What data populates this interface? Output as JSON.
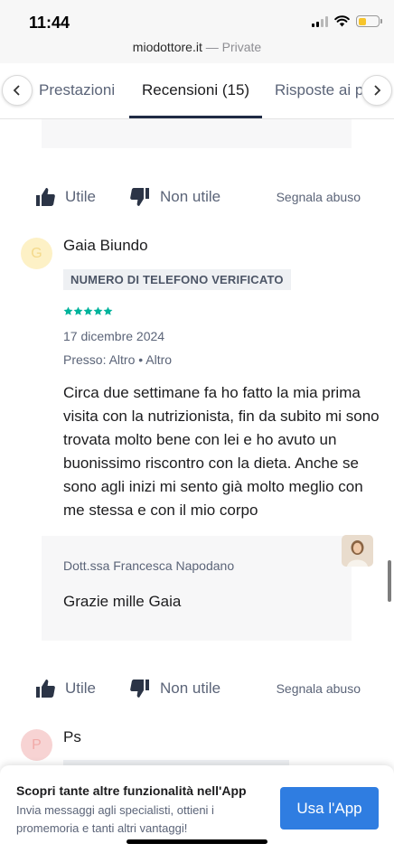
{
  "status_bar": {
    "time": "11:44",
    "battery_level": 0.4
  },
  "browser": {
    "domain": "miodottore.it",
    "mode": "— Private"
  },
  "tabs": [
    {
      "label": "Prestazioni",
      "active": false
    },
    {
      "label": "Recensioni (15)",
      "active": true
    },
    {
      "label": "Risposte ai p",
      "active": false
    }
  ],
  "actions": {
    "useful": "Utile",
    "not_useful": "Non utile",
    "report": "Segnala abuso"
  },
  "reviews": [
    {
      "initial": "G",
      "name": "Gaia Biundo",
      "badge": "NUMERO DI TELEFONO VERIFICATO",
      "rating": 5,
      "date": "17 dicembre 2024",
      "place": "Presso: Altro • Altro",
      "text": "Circa due settimane fa ho fatto la mia prima visita con la nutrizionista, fin da subito mi sono trovata molto bene con lei e ho avuto un buonissimo riscontro con la dieta. Anche se sono agli inizi mi sento già molto meglio con me stessa e con il mio corpo",
      "reply": {
        "author": "Dott.ssa Francesca Napodano",
        "text": "Grazie mille Gaia"
      }
    },
    {
      "initial": "P",
      "name": "Ps"
    }
  ],
  "app_banner": {
    "title": "Scopri tante altre funzionalità nell'App",
    "text": "Invia messaggi agli specialisti, ottieni i promemoria e tanti altri vantaggi!",
    "button": "Usa l'App"
  },
  "colors": {
    "accent": "#2f7de1",
    "star": "#00b39b",
    "tab_underline": "#1f2a44"
  }
}
